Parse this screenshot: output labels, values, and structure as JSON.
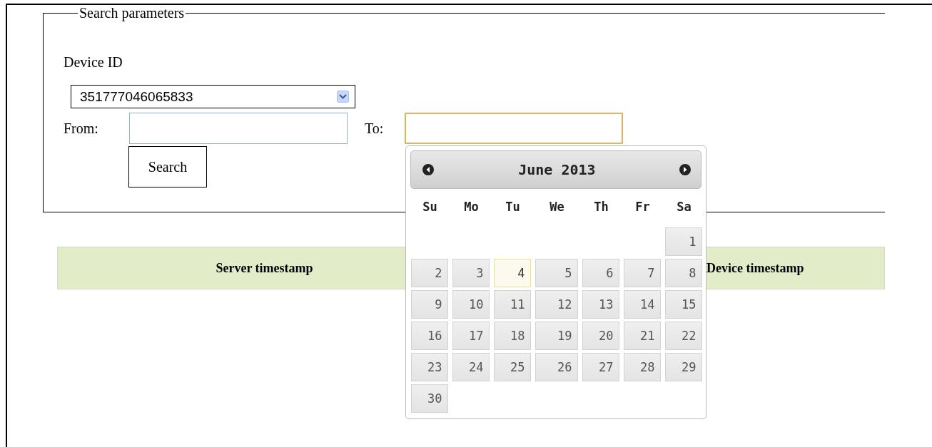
{
  "search_parameters": {
    "legend": "Search parameters",
    "device_label": "Device ID",
    "device_id": "351777046065833",
    "from": {
      "label": "From:",
      "focused": false
    },
    "to": {
      "label": "To:",
      "focused": true
    },
    "search_button": "Search"
  },
  "datepicker": {
    "title": "June 2013",
    "weekdays": [
      "Su",
      "Mo",
      "Tu",
      "We",
      "Th",
      "Fr",
      "Sa"
    ],
    "weeks": [
      {
        "kind": "leading",
        "days": [
          {
            "day": "1",
            "highlighted": false
          }
        ]
      },
      {
        "kind": "full",
        "days": [
          {
            "day": "2",
            "highlighted": false
          },
          {
            "day": "3",
            "highlighted": false
          },
          {
            "day": "4",
            "highlighted": true
          },
          {
            "day": "5",
            "highlighted": false
          },
          {
            "day": "6",
            "highlighted": false
          },
          {
            "day": "7",
            "highlighted": false
          },
          {
            "day": "8",
            "highlighted": false
          }
        ]
      },
      {
        "kind": "full",
        "days": [
          {
            "day": "9",
            "highlighted": false
          },
          {
            "day": "10",
            "highlighted": false
          },
          {
            "day": "11",
            "highlighted": false
          },
          {
            "day": "12",
            "highlighted": false
          },
          {
            "day": "13",
            "highlighted": false
          },
          {
            "day": "14",
            "highlighted": false
          },
          {
            "day": "15",
            "highlighted": false
          }
        ]
      },
      {
        "kind": "full",
        "days": [
          {
            "day": "16",
            "highlighted": false
          },
          {
            "day": "17",
            "highlighted": false
          },
          {
            "day": "18",
            "highlighted": false
          },
          {
            "day": "19",
            "highlighted": false
          },
          {
            "day": "20",
            "highlighted": false
          },
          {
            "day": "21",
            "highlighted": false
          },
          {
            "day": "22",
            "highlighted": false
          }
        ]
      },
      {
        "kind": "full",
        "days": [
          {
            "day": "23",
            "highlighted": false
          },
          {
            "day": "24",
            "highlighted": false
          },
          {
            "day": "25",
            "highlighted": false
          },
          {
            "day": "26",
            "highlighted": false
          },
          {
            "day": "27",
            "highlighted": false
          },
          {
            "day": "28",
            "highlighted": false
          },
          {
            "day": "29",
            "highlighted": false
          }
        ]
      },
      {
        "kind": "trailing",
        "days": [
          {
            "day": "30",
            "highlighted": false
          }
        ]
      }
    ]
  },
  "table": {
    "columns": [
      "Server timestamp",
      "Device timestamp"
    ]
  }
}
